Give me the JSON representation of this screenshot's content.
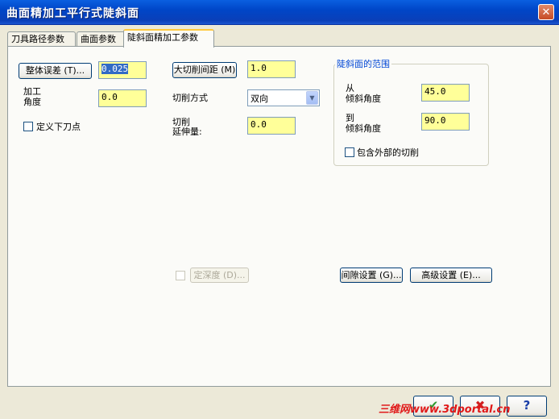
{
  "window": {
    "title": "曲面精加工平行式陡斜面",
    "close_glyph": "✕"
  },
  "tabs": [
    {
      "label": "刀具路径参数",
      "active": false
    },
    {
      "label": "曲面参数",
      "active": false
    },
    {
      "label": "陡斜面精加工参数",
      "active": true
    }
  ],
  "params": {
    "total_error_button": "整体误差 (T)...",
    "total_error_value": "0.025",
    "machining_angle_label_1": "加工",
    "machining_angle_label_2": "角度",
    "machining_angle_value": "0.0",
    "define_lower_point_label": "定义下刀点",
    "max_stepover_button": "大切削间距 (M)",
    "max_stepover_value": "1.0",
    "cut_method_label": "切削方式",
    "cut_method_value": "双向",
    "cut_extension_label_1": "切削",
    "cut_extension_label_2": "延伸量:",
    "cut_extension_value": "0.0"
  },
  "steep_range": {
    "title": "陡斜面的范围",
    "from_label_1": "从",
    "from_label_2": "倾斜角度",
    "from_value": "45.0",
    "to_label_1": "到",
    "to_label_2": "倾斜角度",
    "to_value": "90.0",
    "include_outside_label": "包含外部的切削"
  },
  "lower_buttons": {
    "limit_depth_label": "定深度 (D)...",
    "gap_settings_label": "间隙设置 (G)...",
    "advanced_settings_label": "高级设置 (E)..."
  },
  "footer": {
    "ok_glyph": "✔",
    "cancel_glyph": "✖",
    "help_glyph": "?",
    "watermark": "三维网www.3dportal.cn",
    "ok_color": "#2e9a2e",
    "cancel_color": "#d02020",
    "help_color": "#1a3fa8"
  }
}
